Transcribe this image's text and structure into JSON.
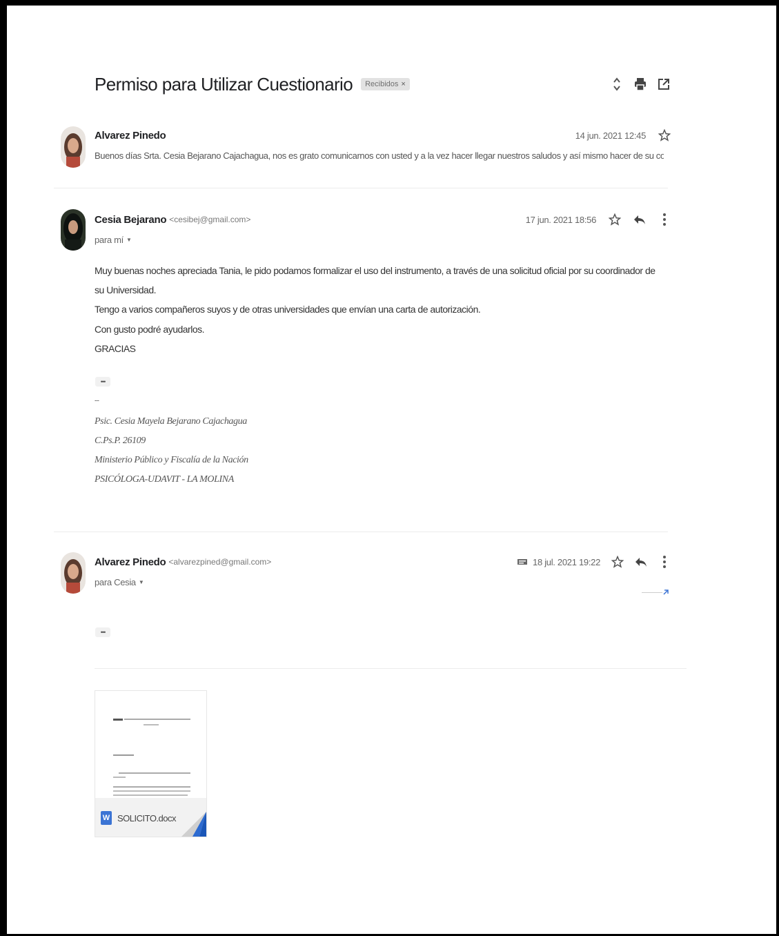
{
  "thread": {
    "subject": "Permiso para Utilizar Cuestionario",
    "label": "Recibidos",
    "label_close": "×"
  },
  "messages": [
    {
      "sender": "Alvarez Pinedo",
      "date": "14 jun. 2021 12:45",
      "snippet": "Buenos días Srta. Cesia Bejarano Cajachagua, nos es grato comunicarnos con usted y a la vez hacer llegar nuestros saludos y así mismo hacer de su cono..."
    },
    {
      "sender": "Cesia Bejarano",
      "email": "<cesibej@gmail.com>",
      "date": "17 jun. 2021 18:56",
      "recipient": "para mí",
      "body_lines": [
        "Muy buenas noches apreciada Tania, le pido podamos formalizar el uso del instrumento, a través de una solicitud oficial por su coordinador de su Universidad.",
        "Tengo a varios compañeros suyos y de otras universidades que envían una carta de autorización."
      ],
      "closing_lines": [
        "Con gusto podré ayudarlos.",
        "GRACIAS"
      ],
      "ellipsis": "•••",
      "sig_dash": "--",
      "signature": [
        "Psic. Cesia Mayela Bejarano Cajachagua",
        "C.Ps.P. 26109",
        "Ministerio Público y Fiscalía de la Nación",
        "PSICÓLOGA-UDAVIT - LA MOLINA"
      ]
    },
    {
      "sender": "Alvarez Pinedo",
      "email": "<alvarezpined@gmail.com>",
      "date": "18 jul. 2021 19:22",
      "recipient": "para Cesia",
      "ellipsis": "•••",
      "attachment": {
        "file_name": "SOLICITO.docx",
        "type_letter": "W"
      }
    }
  ],
  "colors": {
    "word_blue": "#3b74d4",
    "label_bg": "#e2e2e2"
  }
}
